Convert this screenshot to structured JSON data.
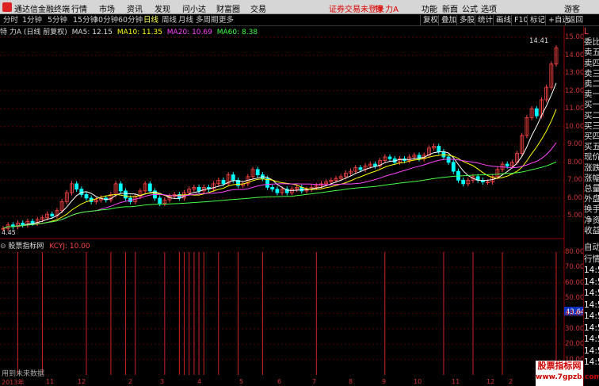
{
  "window": {
    "app_name": "通达信金融终端",
    "menus": [
      "行情",
      "市场",
      "资讯",
      "发现",
      "问小达",
      "财富圈",
      "交易"
    ],
    "login_status": "证券交易未登录",
    "stock_title": "特 力A",
    "right_menus": [
      "功能",
      "新面",
      "公式",
      "选项",
      "游客"
    ]
  },
  "toolbar": {
    "periods": [
      "分时",
      "1分钟",
      "5分钟",
      "15分钟",
      "30分钟",
      "60分钟",
      "日线",
      "周线",
      "月线",
      "多周期",
      "更多"
    ],
    "active": "日线",
    "right_buttons": [
      "复权",
      "叠加",
      "多股",
      "统计",
      "画线",
      "F10",
      "标记",
      "+自选",
      "返回"
    ]
  },
  "main_chart": {
    "title": "特 力A",
    "subtitle": "(日线 前复权)",
    "indicators": [
      {
        "name": "MA5",
        "value": "12.15",
        "color": "#ffffff"
      },
      {
        "name": "MA10",
        "value": "11.35",
        "color": "#ffff00"
      },
      {
        "name": "MA20",
        "value": "10.69",
        "color": "#ff44ff"
      },
      {
        "name": "MA60",
        "value": "8.38",
        "color": "#44ff44"
      }
    ],
    "peak_label": "14.41",
    "low_label": "4.45"
  },
  "sub_chart": {
    "title": "股票指标网",
    "indicator": "KCYJ: 10.00",
    "footer_note": "用到未来数据",
    "current_value": "43.64"
  },
  "side_panel": {
    "items": [
      "L",
      "委比",
      "卖五",
      "卖四",
      "卖三",
      "卖二",
      "卖一",
      "买一",
      "买二",
      "买三",
      "买四",
      "买五",
      "现价",
      "涨跌",
      "涨幅",
      "总量",
      "外盘",
      "换手",
      "净资",
      "收益"
    ],
    "lower_items": [
      "自动",
      "行情",
      "14:5",
      "14:5",
      "14:5",
      "14:5",
      "14:5",
      "14:5",
      "14:5",
      "14:5",
      "14:5"
    ]
  },
  "watermark": {
    "line1": "股票指标网",
    "line2": "www.7gpzb.com"
  },
  "dates": [
    "2013年",
    "11",
    "12",
    "2",
    "3",
    "4",
    "5",
    "6",
    "7",
    "8",
    "9",
    "10",
    "11",
    "12",
    "2"
  ],
  "colors": {
    "bg": "#000000",
    "grid": "#660000",
    "axis": "#cc3333",
    "up": "#ff4444",
    "down": "#00ffff"
  },
  "chart_data": {
    "type": "line",
    "ylim": [
      4.0,
      15.0
    ],
    "y_ticks": [
      "15.00",
      "14.00",
      "13.00",
      "12.00",
      "11.00",
      "10.00",
      "9.00",
      "8.00",
      "7.00",
      "6.00",
      "5.00",
      "4.45"
    ],
    "sub_ylim": [
      0,
      80
    ],
    "sub_ticks": [
      "80.00",
      "70.00",
      "60.00",
      "50.00",
      "40.00",
      "30.00",
      "20.00",
      "10.00"
    ],
    "price": [
      4.3,
      4.5,
      4.4,
      4.6,
      4.5,
      4.7,
      4.6,
      4.8,
      4.9,
      5.1,
      5.0,
      5.3,
      5.8,
      6.3,
      6.8,
      6.5,
      6.2,
      6.0,
      5.8,
      5.9,
      6.0,
      5.9,
      6.2,
      6.8,
      6.4,
      6.0,
      5.8,
      6.1,
      6.4,
      6.8,
      6.4,
      6.0,
      5.7,
      5.9,
      6.1,
      6.2,
      6.0,
      6.3,
      6.5,
      6.6,
      6.4,
      6.6,
      6.5,
      6.8,
      7.0,
      6.8,
      7.3,
      7.0,
      6.7,
      6.8,
      7.2,
      7.6,
      7.3,
      7.1,
      6.6,
      6.5,
      6.3,
      6.5,
      6.3,
      6.5,
      6.6,
      6.4,
      6.5,
      6.6,
      6.7,
      6.8,
      6.9,
      7.0,
      7.1,
      7.2,
      7.4,
      7.5,
      7.7,
      7.6,
      7.8,
      7.9,
      7.8,
      8.1,
      8.3,
      8.2,
      8.0,
      8.2,
      8.1,
      8.3,
      8.4,
      8.2,
      8.4,
      8.8,
      8.9,
      8.6,
      8.3,
      8.0,
      7.5,
      7.0,
      6.8,
      7.0,
      7.2,
      7.0,
      6.9,
      6.9,
      7.2,
      7.6,
      7.9,
      7.8,
      8.0,
      8.5,
      9.5,
      10.5,
      11.0,
      10.6,
      11.5,
      12.2,
      13.5,
      14.4
    ],
    "kcyj_signals": [
      3,
      8,
      17,
      22,
      25,
      27,
      33,
      36,
      37,
      38,
      39,
      40,
      41,
      44,
      48,
      53,
      64,
      78,
      90,
      96,
      102,
      113
    ]
  }
}
